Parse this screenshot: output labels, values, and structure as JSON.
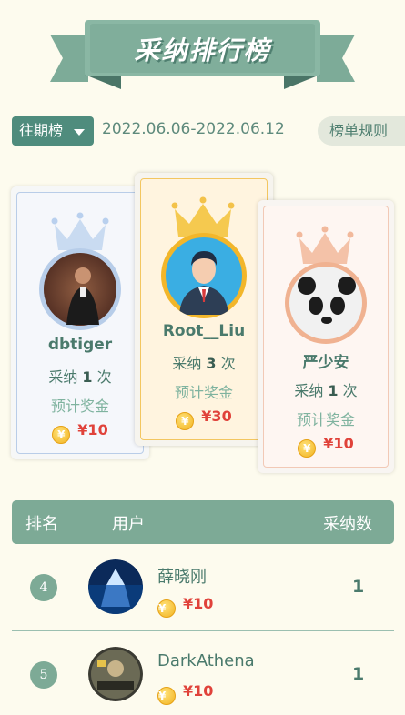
{
  "banner": {
    "title": "采纳排行榜"
  },
  "filter": {
    "period_label": "往期榜",
    "date_range": "2022.06.06-2022.06.12",
    "rules_label": "榜单规则"
  },
  "podium": [
    {
      "rank": 1,
      "name": "Root__Liu",
      "adopt_prefix": "采纳",
      "count": "3",
      "adopt_suffix": "次",
      "bonus_label": "预计奖金",
      "bonus": "¥30",
      "crown_color": "#f3c24a"
    },
    {
      "rank": 2,
      "name": "dbtiger",
      "adopt_prefix": "采纳",
      "count": "1",
      "adopt_suffix": "次",
      "bonus_label": "预计奖金",
      "bonus": "¥10",
      "crown_color": "#b9d0ee"
    },
    {
      "rank": 3,
      "name": "严少安",
      "adopt_prefix": "采纳",
      "count": "1",
      "adopt_suffix": "次",
      "bonus_label": "预计奖金",
      "bonus": "¥10",
      "crown_color": "#f2b99c"
    }
  ],
  "table": {
    "headers": {
      "rank": "排名",
      "user": "用户",
      "count": "采纳数"
    },
    "rows": [
      {
        "rank": "4",
        "name": "薛晓刚",
        "bonus": "¥10",
        "count": "1"
      },
      {
        "rank": "5",
        "name": "DarkAthena",
        "bonus": "¥10",
        "count": "1"
      }
    ]
  },
  "colors": {
    "accent": "#7daa96",
    "bonus_red": "#e0423a",
    "background": "#fdfbee"
  }
}
